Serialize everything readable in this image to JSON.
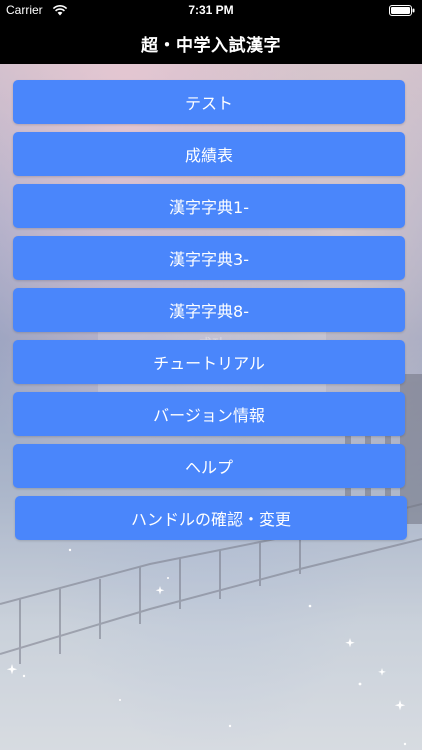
{
  "status_bar": {
    "carrier": "Carrier",
    "time": "7:31 PM"
  },
  "nav": {
    "title": "超・中学入試漢字"
  },
  "overlay": {
    "text": "成功"
  },
  "menu": {
    "items": [
      {
        "label": "テスト"
      },
      {
        "label": "成績表"
      },
      {
        "label": "漢字字典1-"
      },
      {
        "label": "漢字字典3-"
      },
      {
        "label": "漢字字典8-"
      },
      {
        "label": "チュートリアル"
      },
      {
        "label": "バージョン情報"
      },
      {
        "label": "ヘルプ"
      },
      {
        "label": "ハンドルの確認・変更"
      }
    ]
  },
  "colors": {
    "button": "#4a86fb",
    "nav_background": "#000000"
  }
}
